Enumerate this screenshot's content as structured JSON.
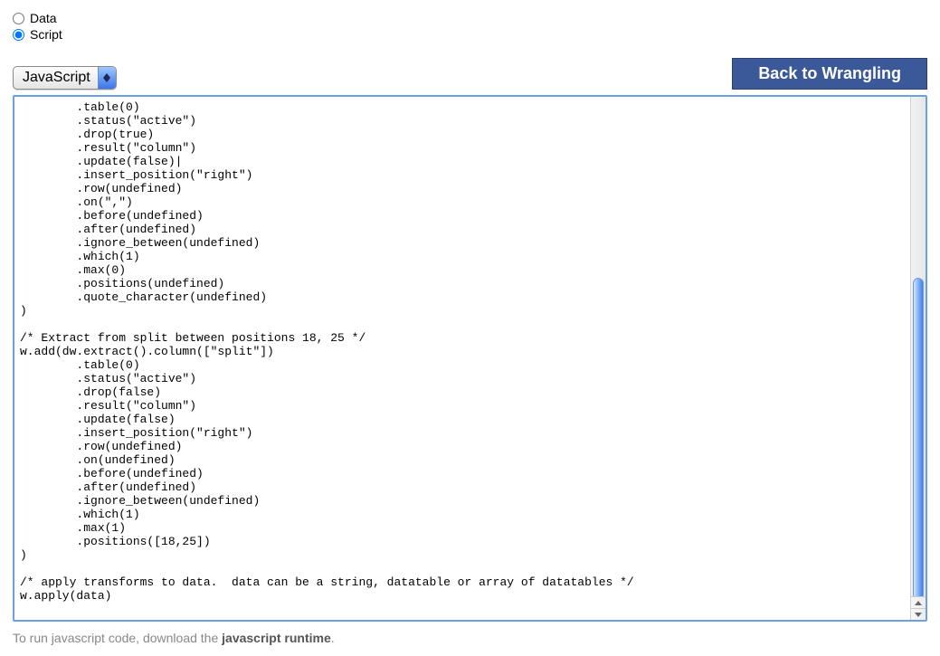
{
  "radios": {
    "data_label": "Data",
    "script_label": "Script",
    "selected": "script"
  },
  "toolbar": {
    "language_select": "JavaScript",
    "back_button": "Back to Wrangling"
  },
  "code": "        .table(0)\n        .status(\"active\")\n        .drop(true)\n        .result(\"column\")\n        .update(false)|\n        .insert_position(\"right\")\n        .row(undefined)\n        .on(\",\")\n        .before(undefined)\n        .after(undefined)\n        .ignore_between(undefined)\n        .which(1)\n        .max(0)\n        .positions(undefined)\n        .quote_character(undefined)\n)\n\n/* Extract from split between positions 18, 25 */\nw.add(dw.extract().column([\"split\"])\n        .table(0)\n        .status(\"active\")\n        .drop(false)\n        .result(\"column\")\n        .update(false)\n        .insert_position(\"right\")\n        .row(undefined)\n        .on(undefined)\n        .before(undefined)\n        .after(undefined)\n        .ignore_between(undefined)\n        .which(1)\n        .max(1)\n        .positions([18,25])\n)\n\n/* apply transforms to data.  data can be a string, datatable or array of datatables */\nw.apply(data)",
  "footer": {
    "prefix": "To run javascript code, download the ",
    "link": "javascript runtime",
    "suffix": "."
  }
}
